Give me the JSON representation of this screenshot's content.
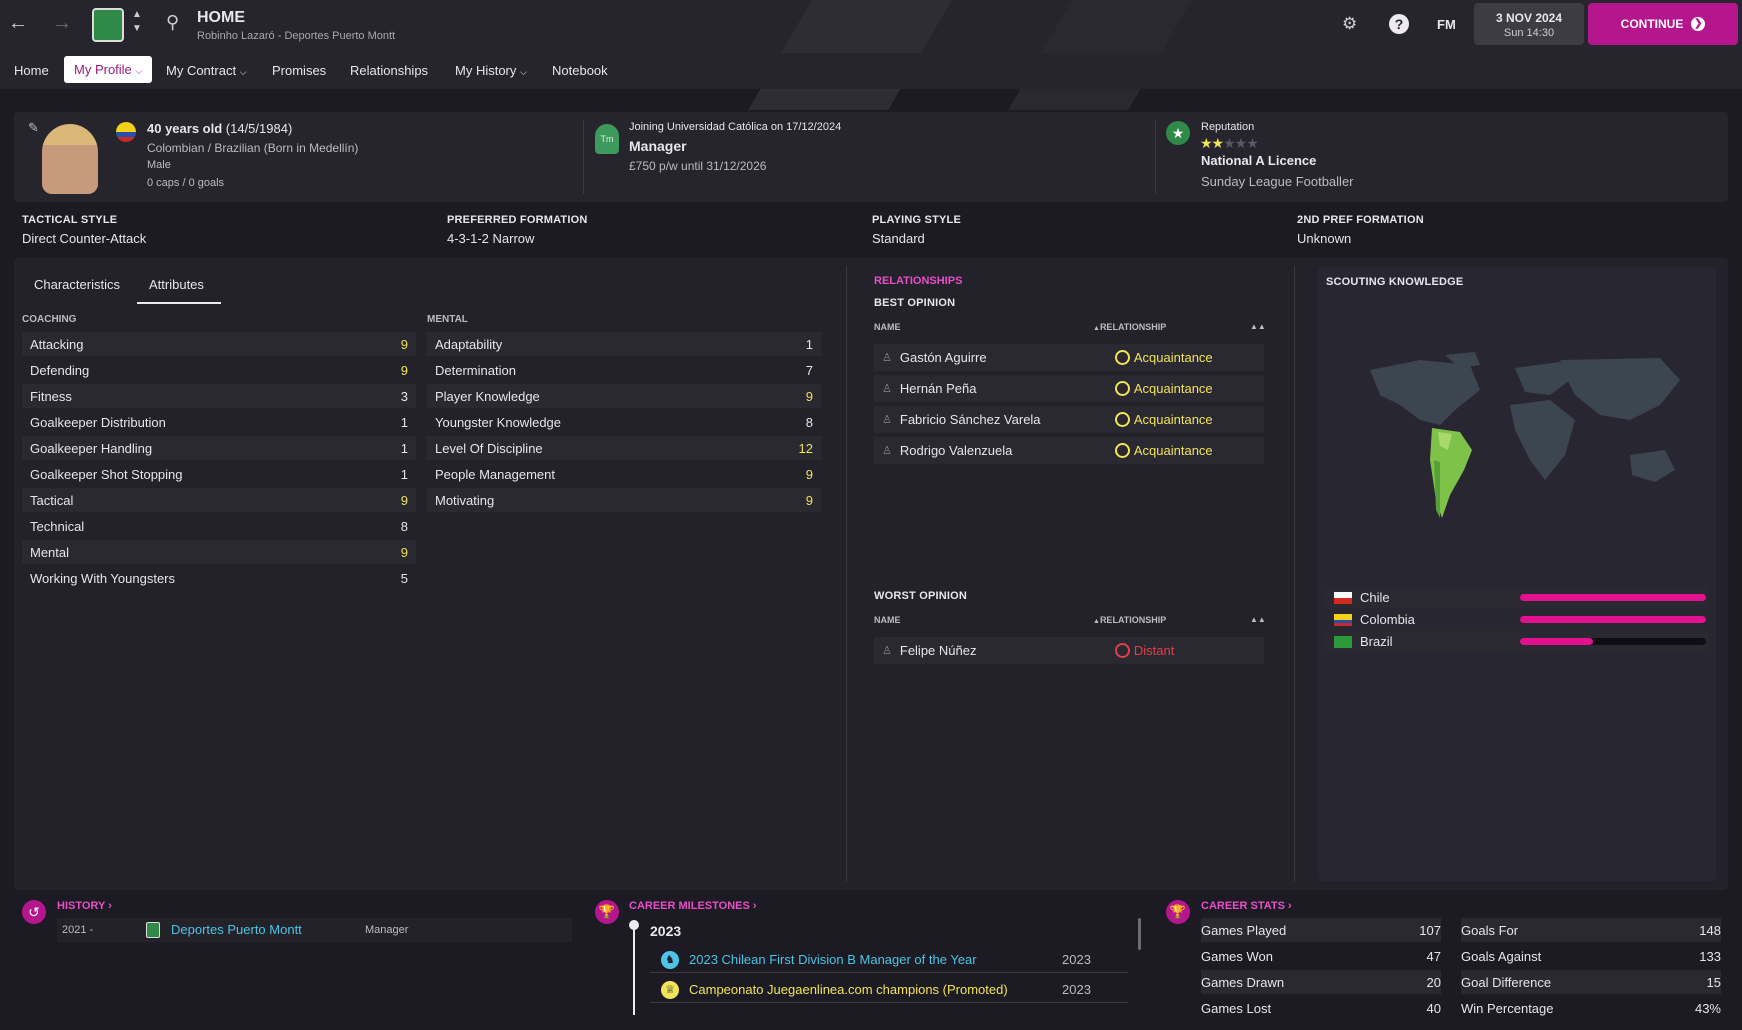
{
  "header": {
    "title": "HOME",
    "subtitle": "Robinho Lazaró - Deportes Puerto Montt",
    "fm_label": "FM",
    "date": "3 NOV 2024",
    "time": "Sun 14:30",
    "continue": "CONTINUE"
  },
  "nav": [
    "Home",
    "My Profile",
    "My Contract",
    "Promises",
    "Relationships",
    "My History",
    "Notebook"
  ],
  "profile": {
    "age": "40 years old",
    "dob": "(14/5/1984)",
    "nationality": "Colombian / Brazilian (Born in Medellín)",
    "gender": "Male",
    "caps": "0 caps / 0 goals"
  },
  "contract": {
    "joining": "Joining Universidad Católica on 17/12/2024",
    "role": "Manager",
    "wage": "£750 p/w until 31/12/2026",
    "club_badge_text": "Tm"
  },
  "reputation": {
    "label": "Reputation",
    "stars": 2,
    "stars_max": 5,
    "licence": "National A Licence",
    "level": "Sunday League Footballer"
  },
  "style": [
    {
      "label": "TACTICAL STYLE",
      "value": "Direct Counter-Attack"
    },
    {
      "label": "PREFERRED FORMATION",
      "value": "4-3-1-2 Narrow"
    },
    {
      "label": "PLAYING STYLE",
      "value": "Standard"
    },
    {
      "label": "2ND PREF FORMATION",
      "value": "Unknown"
    }
  ],
  "tabs": [
    "Characteristics",
    "Attributes"
  ],
  "coaching": {
    "label": "COACHING",
    "items": [
      [
        "Attacking",
        "9"
      ],
      [
        "Defending",
        "9"
      ],
      [
        "Fitness",
        "3"
      ],
      [
        "Goalkeeper Distribution",
        "1"
      ],
      [
        "Goalkeeper Handling",
        "1"
      ],
      [
        "Goalkeeper Shot Stopping",
        "1"
      ],
      [
        "Tactical",
        "9"
      ],
      [
        "Technical",
        "8"
      ],
      [
        "Mental",
        "9"
      ],
      [
        "Working With Youngsters",
        "5"
      ]
    ]
  },
  "mental": {
    "label": "MENTAL",
    "items": [
      [
        "Adaptability",
        "1"
      ],
      [
        "Determination",
        "7"
      ],
      [
        "Player Knowledge",
        "9"
      ],
      [
        "Youngster Knowledge",
        "8"
      ],
      [
        "Level Of Discipline",
        "12"
      ],
      [
        "People Management",
        "9"
      ],
      [
        "Motivating",
        "9"
      ]
    ]
  },
  "relationships": {
    "title": "RELATIONSHIPS",
    "best_title": "BEST OPINION",
    "worst_title": "WORST OPINION",
    "col_name": "NAME",
    "col_rel": "RELATIONSHIP",
    "best": [
      [
        "Gastón Aguirre",
        "Acquaintance"
      ],
      [
        "Hernán Peña",
        "Acquaintance"
      ],
      [
        "Fabricio Sánchez Varela",
        "Acquaintance"
      ],
      [
        "Rodrigo Valenzuela",
        "Acquaintance"
      ]
    ],
    "worst": [
      [
        "Felipe Núñez",
        "Distant"
      ]
    ]
  },
  "scouting": {
    "title": "SCOUTING KNOWLEDGE",
    "countries": [
      {
        "name": "Chile",
        "pct": 1.0
      },
      {
        "name": "Colombia",
        "pct": 1.0
      },
      {
        "name": "Brazil",
        "pct": 0.39
      }
    ]
  },
  "history": {
    "title": "HISTORY",
    "year": "2021 -",
    "club": "Deportes Puerto Montt",
    "role": "Manager"
  },
  "milestones": {
    "title": "CAREER MILESTONES",
    "year": "2023",
    "items": [
      [
        "2023 Chilean First Division B Manager of the Year",
        "2023"
      ],
      [
        "Campeonato Juegaenlinea.com champions (Promoted)",
        "2023"
      ]
    ]
  },
  "stats": {
    "title": "CAREER STATS",
    "left": [
      [
        "Games Played",
        "107"
      ],
      [
        "Games Won",
        "47"
      ],
      [
        "Games Drawn",
        "20"
      ],
      [
        "Games Lost",
        "40"
      ]
    ],
    "right": [
      [
        "Goals For",
        "148"
      ],
      [
        "Goals Against",
        "133"
      ],
      [
        "Goal Difference",
        "15"
      ],
      [
        "Win Percentage",
        "43%"
      ]
    ]
  },
  "colors": {
    "accent": "#e84fc9",
    "continue": "#b5168e",
    "yellow": "#f1e45a",
    "red": "#e0404a",
    "cyan": "#4cc4e8"
  }
}
